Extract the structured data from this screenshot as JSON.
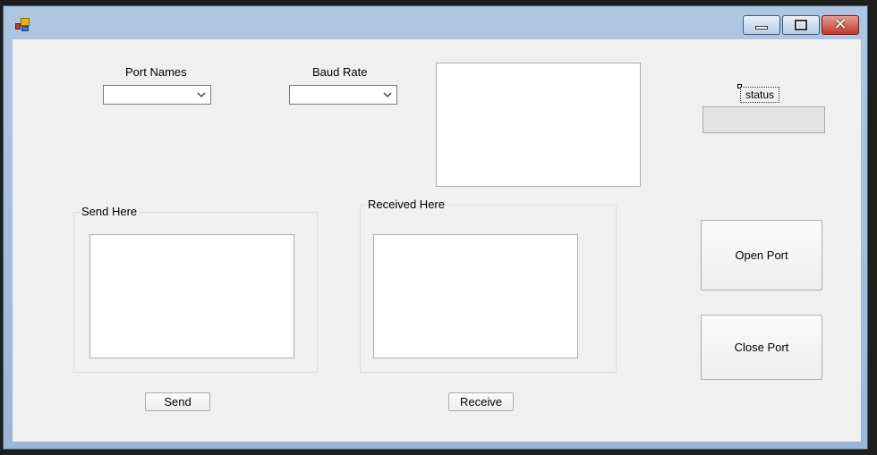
{
  "window": {
    "controls": {
      "minimize": "minimize",
      "maximize": "maximize",
      "close": "close"
    }
  },
  "port_names": {
    "label": "Port Names",
    "value": ""
  },
  "baud_rate": {
    "label": "Baud Rate",
    "value": ""
  },
  "status": {
    "label": "status",
    "value": ""
  },
  "send_group": {
    "caption": "Send Here",
    "text": ""
  },
  "receive_group": {
    "caption": "Received Here",
    "text": ""
  },
  "buttons": {
    "send": "Send",
    "receive": "Receive",
    "open_port": "Open Port",
    "close_port": "Close Port"
  },
  "colors": {
    "client_bg": "#f0f0f0",
    "titlebar": "#aec6e2",
    "close_button": "#c0392b"
  }
}
